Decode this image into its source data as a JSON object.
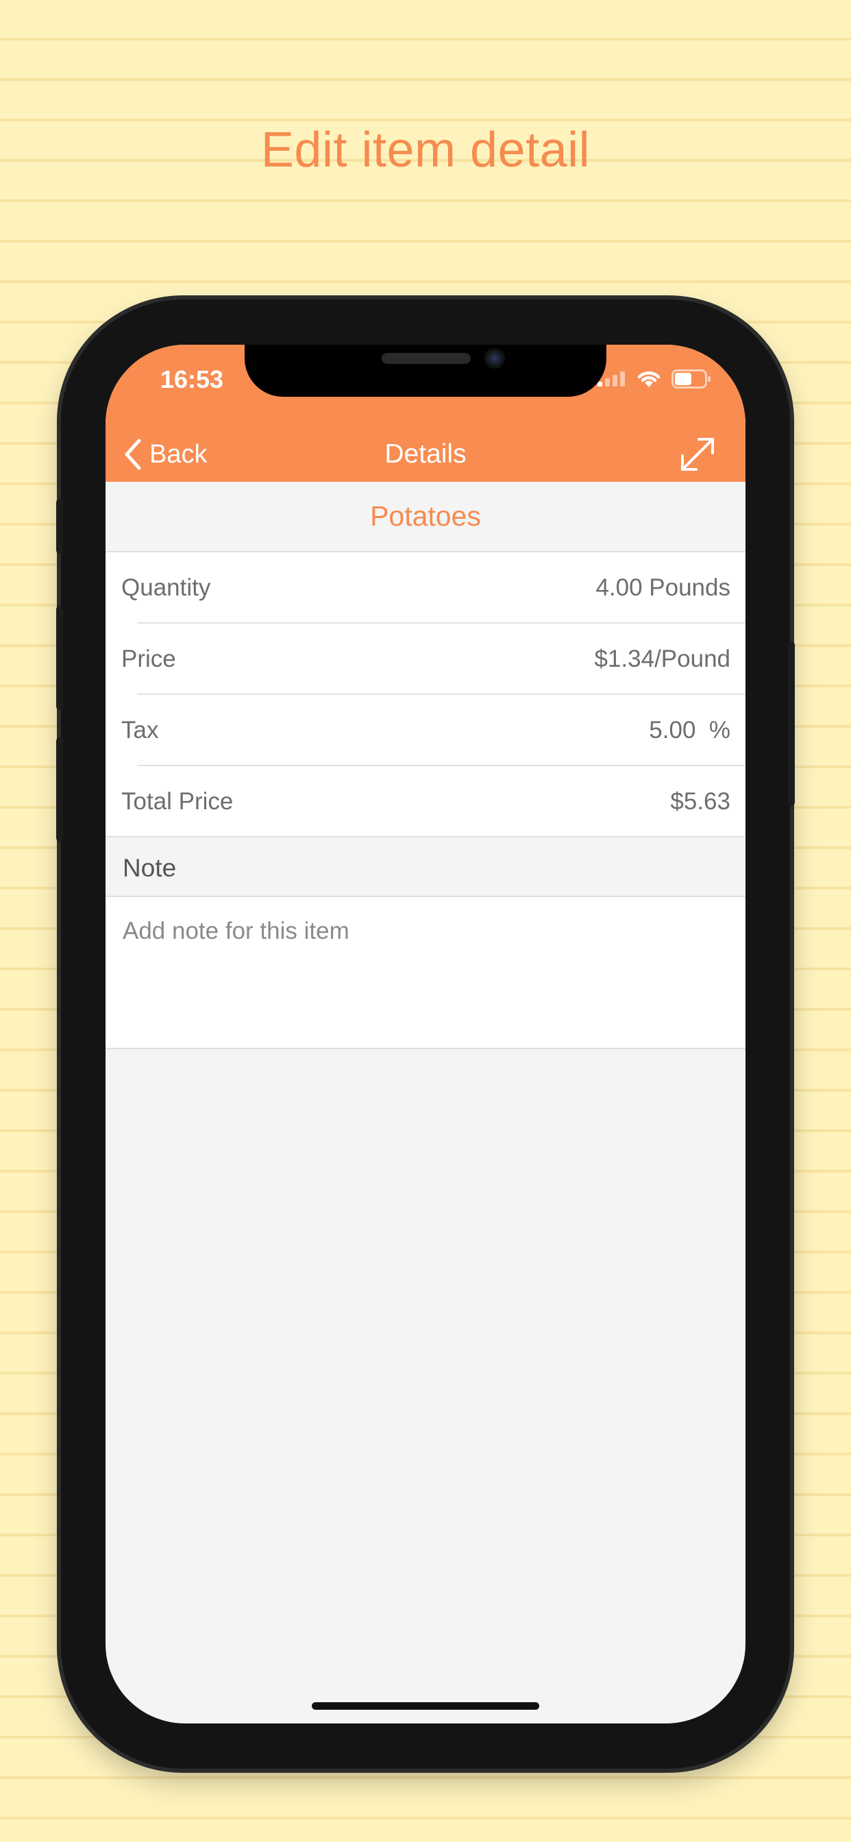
{
  "headline": "Edit item detail",
  "status_bar": {
    "time": "16:53"
  },
  "nav": {
    "back_label": "Back",
    "title": "Details"
  },
  "item": {
    "name": "Potatoes"
  },
  "details": [
    {
      "label": "Quantity",
      "value": "4.00 Pounds"
    },
    {
      "label": "Price",
      "value": "$1.34/Pound"
    },
    {
      "label": "Tax",
      "value": "5.00  %"
    },
    {
      "label": "Total Price",
      "value": "$5.63"
    }
  ],
  "note": {
    "header": "Note",
    "placeholder": "Add note for this item"
  },
  "colors": {
    "accent": "#f88c51",
    "headline": "#f68b50",
    "paper": "#fef3bd",
    "paper_line": "#f7e3a0"
  },
  "icons": {
    "back": "chevron-left-icon",
    "expand": "expand-arrows-icon"
  }
}
